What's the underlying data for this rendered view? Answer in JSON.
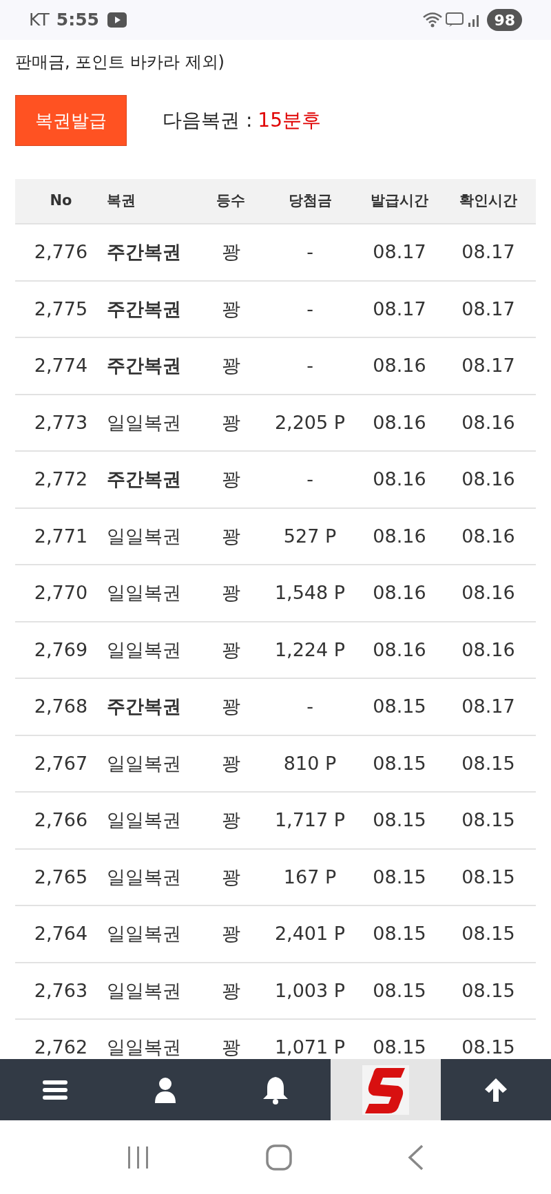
{
  "status_bar": {
    "carrier": "KT",
    "time": "5:55",
    "battery": "98"
  },
  "note": "판매금, 포인트 바카라 제외)",
  "issue_button": "복권발급",
  "next": {
    "label": "다음복권",
    "separator": ":",
    "value": "15분후"
  },
  "table": {
    "columns": [
      "No",
      "복권",
      "등수",
      "당첨금",
      "발급시간",
      "확인시간"
    ],
    "rows": [
      {
        "no": "2,776",
        "kind": "weekly",
        "name": "주간복권",
        "rank": "꽝",
        "prize": "-",
        "issued": "08.17",
        "checked_at": "08.17"
      },
      {
        "no": "2,775",
        "kind": "weekly",
        "name": "주간복권",
        "rank": "꽝",
        "prize": "-",
        "issued": "08.17",
        "checked_at": "08.17"
      },
      {
        "no": "2,774",
        "kind": "weekly",
        "name": "주간복권",
        "rank": "꽝",
        "prize": "-",
        "issued": "08.16",
        "checked_at": "08.17"
      },
      {
        "no": "2,773",
        "kind": "daily",
        "name": "일일복권",
        "rank": "꽝",
        "prize": "2,205 P",
        "issued": "08.16",
        "checked_at": "08.16"
      },
      {
        "no": "2,772",
        "kind": "weekly",
        "name": "주간복권",
        "rank": "꽝",
        "prize": "-",
        "issued": "08.16",
        "checked_at": "08.16"
      },
      {
        "no": "2,771",
        "kind": "daily",
        "name": "일일복권",
        "rank": "꽝",
        "prize": "527 P",
        "issued": "08.16",
        "checked_at": "08.16"
      },
      {
        "no": "2,770",
        "kind": "daily",
        "name": "일일복권",
        "rank": "꽝",
        "prize": "1,548 P",
        "issued": "08.16",
        "checked_at": "08.16"
      },
      {
        "no": "2,769",
        "kind": "daily",
        "name": "일일복권",
        "rank": "꽝",
        "prize": "1,224 P",
        "issued": "08.16",
        "checked_at": "08.16"
      },
      {
        "no": "2,768",
        "kind": "weekly",
        "name": "주간복권",
        "rank": "꽝",
        "prize": "-",
        "issued": "08.15",
        "checked_at": "08.17"
      },
      {
        "no": "2,767",
        "kind": "daily",
        "name": "일일복권",
        "rank": "꽝",
        "prize": "810 P",
        "issued": "08.15",
        "checked_at": "08.15"
      },
      {
        "no": "2,766",
        "kind": "daily",
        "name": "일일복권",
        "rank": "꽝",
        "prize": "1,717 P",
        "issued": "08.15",
        "checked_at": "08.15"
      },
      {
        "no": "2,765",
        "kind": "daily",
        "name": "일일복권",
        "rank": "꽝",
        "prize": "167 P",
        "issued": "08.15",
        "checked_at": "08.15"
      },
      {
        "no": "2,764",
        "kind": "daily",
        "name": "일일복권",
        "rank": "꽝",
        "prize": "2,401 P",
        "issued": "08.15",
        "checked_at": "08.15"
      },
      {
        "no": "2,763",
        "kind": "daily",
        "name": "일일복권",
        "rank": "꽝",
        "prize": "1,003 P",
        "issued": "08.15",
        "checked_at": "08.15"
      },
      {
        "no": "2,762",
        "kind": "daily",
        "name": "일일복권",
        "rank": "꽝",
        "prize": "1,071 P",
        "issued": "08.15",
        "checked_at": "08.15"
      }
    ]
  }
}
